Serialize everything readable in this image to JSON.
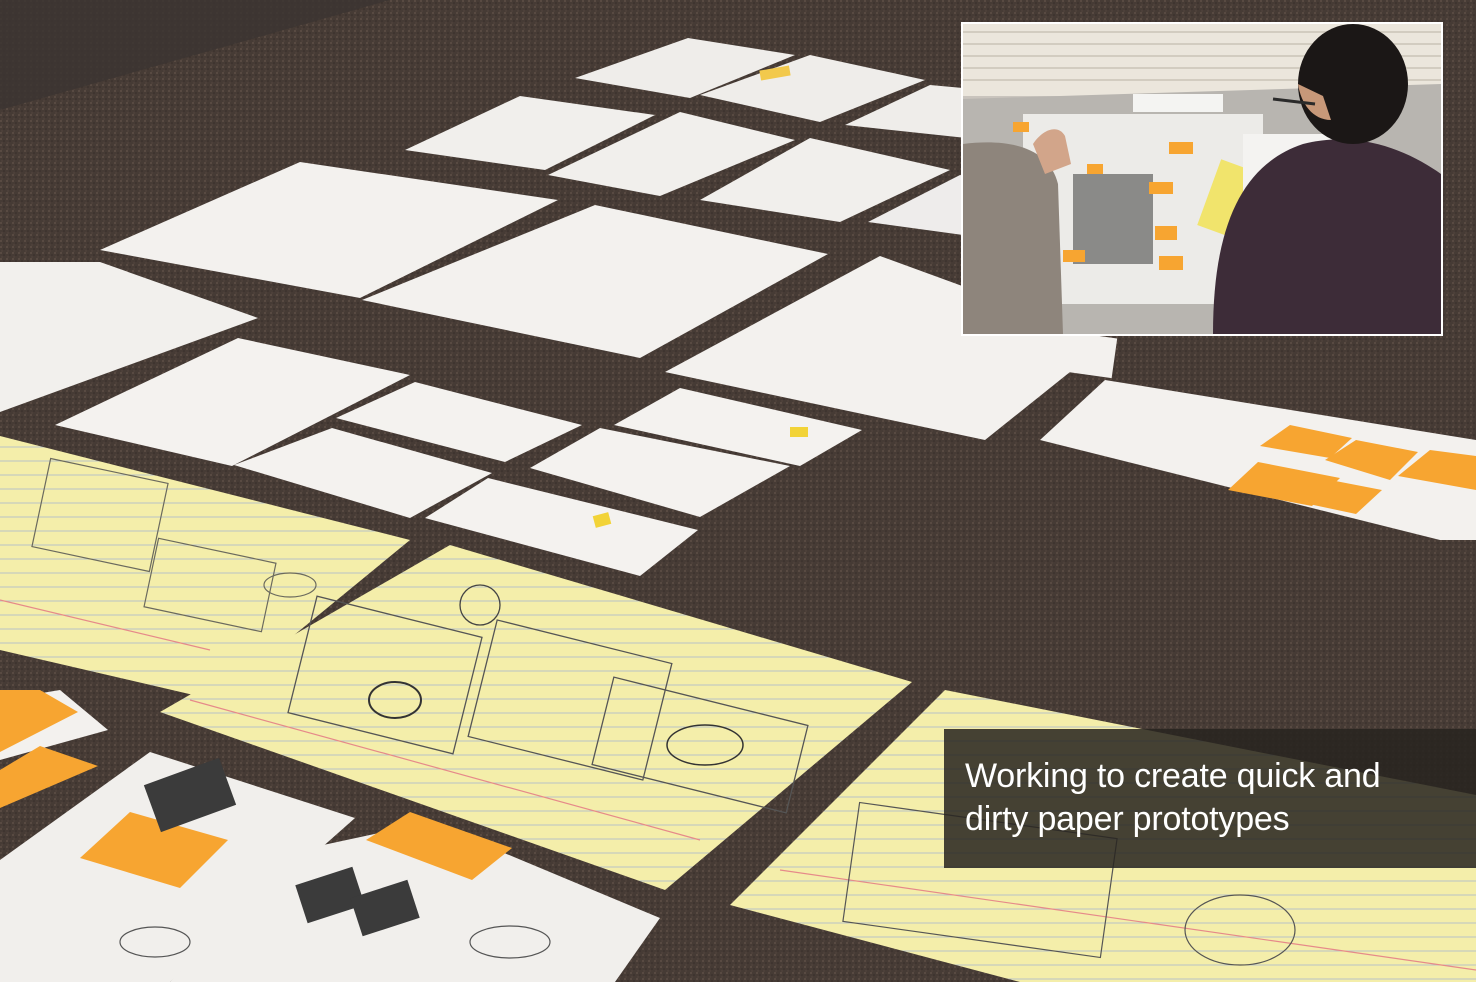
{
  "photo": {
    "scene": "paper prototype sketches spread on carpet floor",
    "colors": {
      "carpet": "#4a3e38",
      "paper_white": "#f3f1ee",
      "legal_pad": "#f4eeaa",
      "sticky_note": "#f7a531",
      "caption_bg": "#282420"
    }
  },
  "inset": {
    "scene": "two people arranging paper prototypes on a table"
  },
  "caption": {
    "line1": "Working to create quick and",
    "line2": "dirty paper prototypes"
  }
}
